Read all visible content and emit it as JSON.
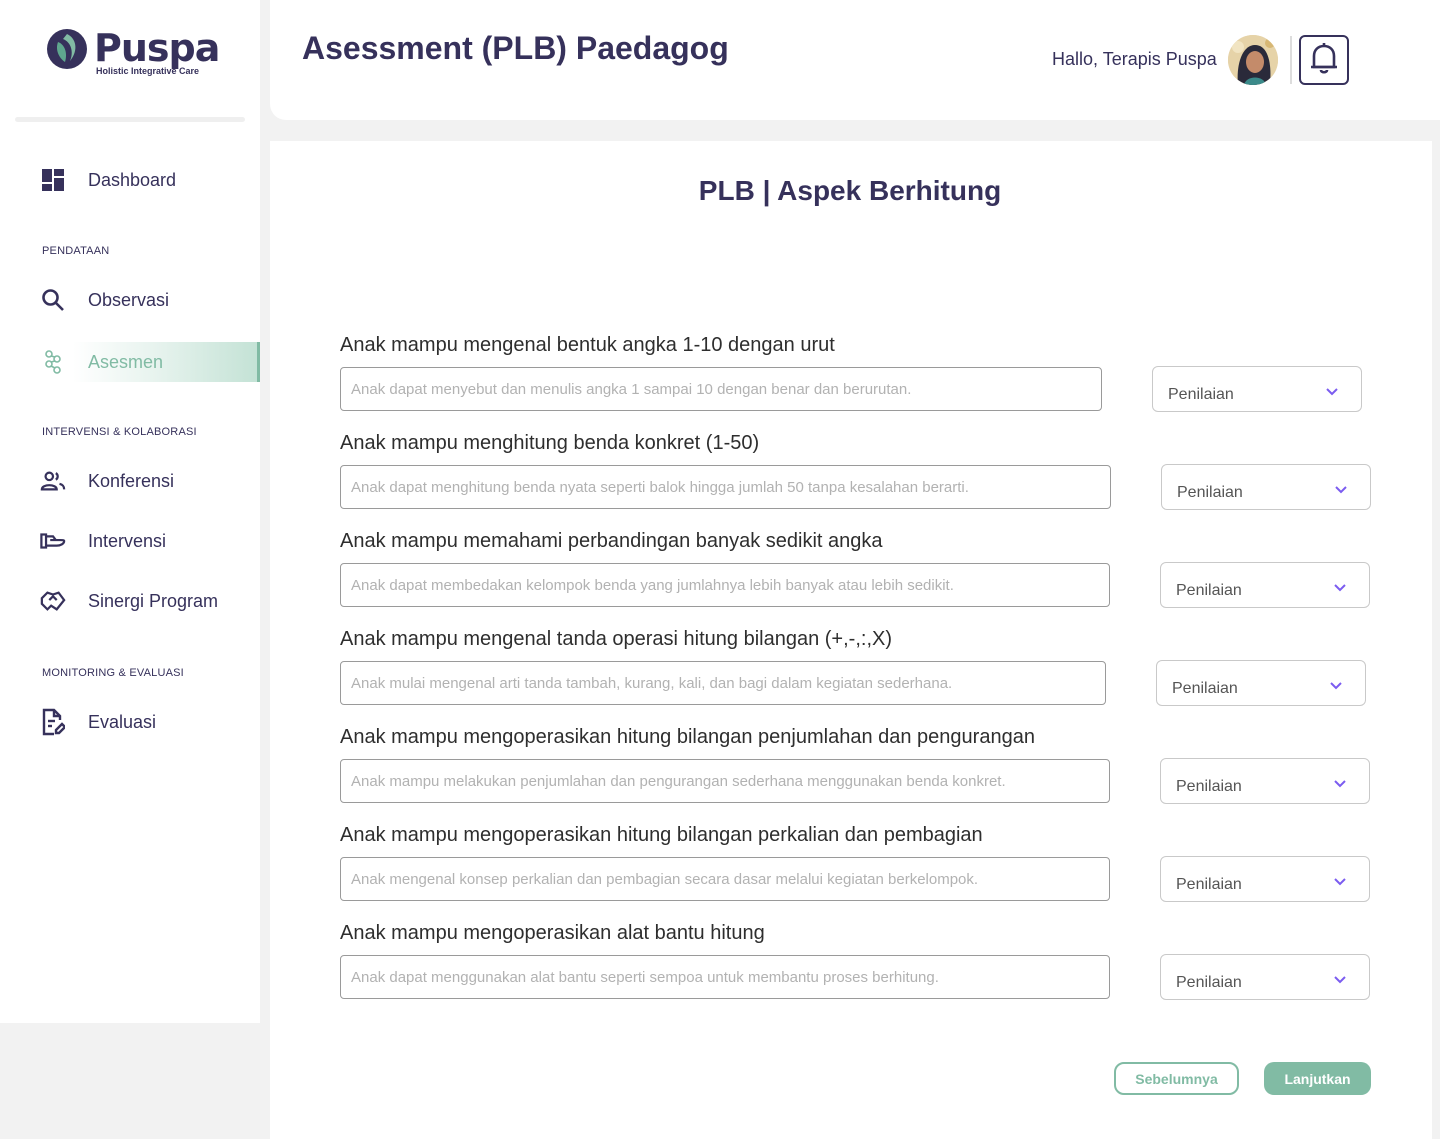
{
  "app": {
    "logo_name": "Puspa",
    "logo_tagline": "Holistic Integrative Care"
  },
  "sidebar": {
    "dashboard": "Dashboard",
    "sections": {
      "pendataan": "PENDATAAN",
      "intervensi": "INTERVENSI & KOLABORASI",
      "monitoring": "MONITORING & EVALUASI"
    },
    "items": {
      "observasi": "Observasi",
      "asesmen": "Asesmen",
      "konferensi": "Konferensi",
      "intervensi": "Intervensi",
      "sinergi": "Sinergi Program",
      "evaluasi": "Evaluasi"
    }
  },
  "header": {
    "title": "Asessment (PLB) Paedagog",
    "greeting": "Hallo, Terapis Puspa"
  },
  "form": {
    "title": "PLB | Aspek Berhitung",
    "select_placeholder": "Penilaian",
    "questions": [
      {
        "label": "Anak mampu mengenal bentuk angka 1-10 dengan urut",
        "placeholder": "Anak dapat menyebut dan menulis angka 1 sampai 10 dengan benar dan berurutan."
      },
      {
        "label": "Anak mampu menghitung benda konkret (1-50)",
        "placeholder": "Anak dapat menghitung benda nyata seperti balok hingga jumlah 50 tanpa kesalahan berarti."
      },
      {
        "label": "Anak mampu memahami perbandingan banyak sedikit angka",
        "placeholder": "Anak dapat membedakan kelompok benda yang jumlahnya lebih banyak atau lebih sedikit."
      },
      {
        "label": "Anak mampu mengenal tanda operasi hitung bilangan (+,-,:,X)",
        "placeholder": "Anak mulai mengenal arti tanda tambah, kurang, kali, dan bagi dalam kegiatan sederhana."
      },
      {
        "label": "Anak mampu mengoperasikan hitung bilangan penjumlahan dan pengurangan",
        "placeholder": "Anak mampu melakukan penjumlahan dan pengurangan sederhana menggunakan benda konkret."
      },
      {
        "label": "Anak mampu mengoperasikan hitung bilangan perkalian dan pembagian",
        "placeholder": "Anak mengenal konsep perkalian dan pembagian secara dasar melalui kegiatan berkelompok."
      },
      {
        "label": "Anak mampu mengoperasikan alat bantu hitung",
        "placeholder": "Anak dapat menggunakan alat bantu seperti sempoa untuk membantu proses berhitung."
      }
    ],
    "prev_label": "Sebelumnya",
    "next_label": "Lanjutkan"
  },
  "colors": {
    "primary": "#36315b",
    "accent": "#81bba4",
    "chevron": "#7b5cf0"
  },
  "icons": [
    "dashboard-icon",
    "search-icon",
    "asesmen-icon",
    "people-icon",
    "hand-icon",
    "handshake-icon",
    "document-edit-icon",
    "bell-icon"
  ]
}
